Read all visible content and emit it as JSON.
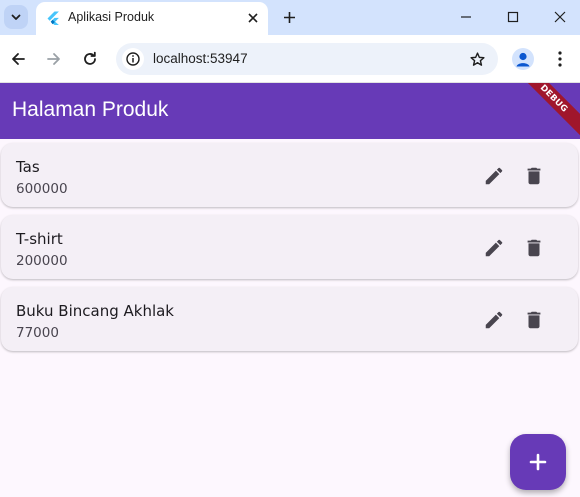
{
  "browser": {
    "tab_title": "Aplikasi Produk",
    "url": "localhost:53947"
  },
  "app": {
    "title": "Halaman Produk",
    "debug_label": "DEBUG",
    "colors": {
      "primary": "#673ab7",
      "card": "#f4eff6",
      "background": "#fdf7fe",
      "debug": "#a0162c"
    }
  },
  "products": [
    {
      "name": "Tas",
      "price": "600000"
    },
    {
      "name": "T-shirt",
      "price": "200000"
    },
    {
      "name": "Buku Bincang Akhlak",
      "price": "77000"
    }
  ],
  "icons": {
    "tab_search": "chevron-down-icon",
    "favicon": "flutter-icon",
    "close": "close-icon",
    "new_tab": "plus-icon",
    "back": "arrow-left-icon",
    "forward": "arrow-right-icon",
    "reload": "reload-icon",
    "site_info": "info-icon",
    "bookmark": "star-icon",
    "profile": "person-icon",
    "menu": "more-vert-icon",
    "edit": "pencil-icon",
    "delete": "trash-icon",
    "fab": "plus-icon"
  }
}
